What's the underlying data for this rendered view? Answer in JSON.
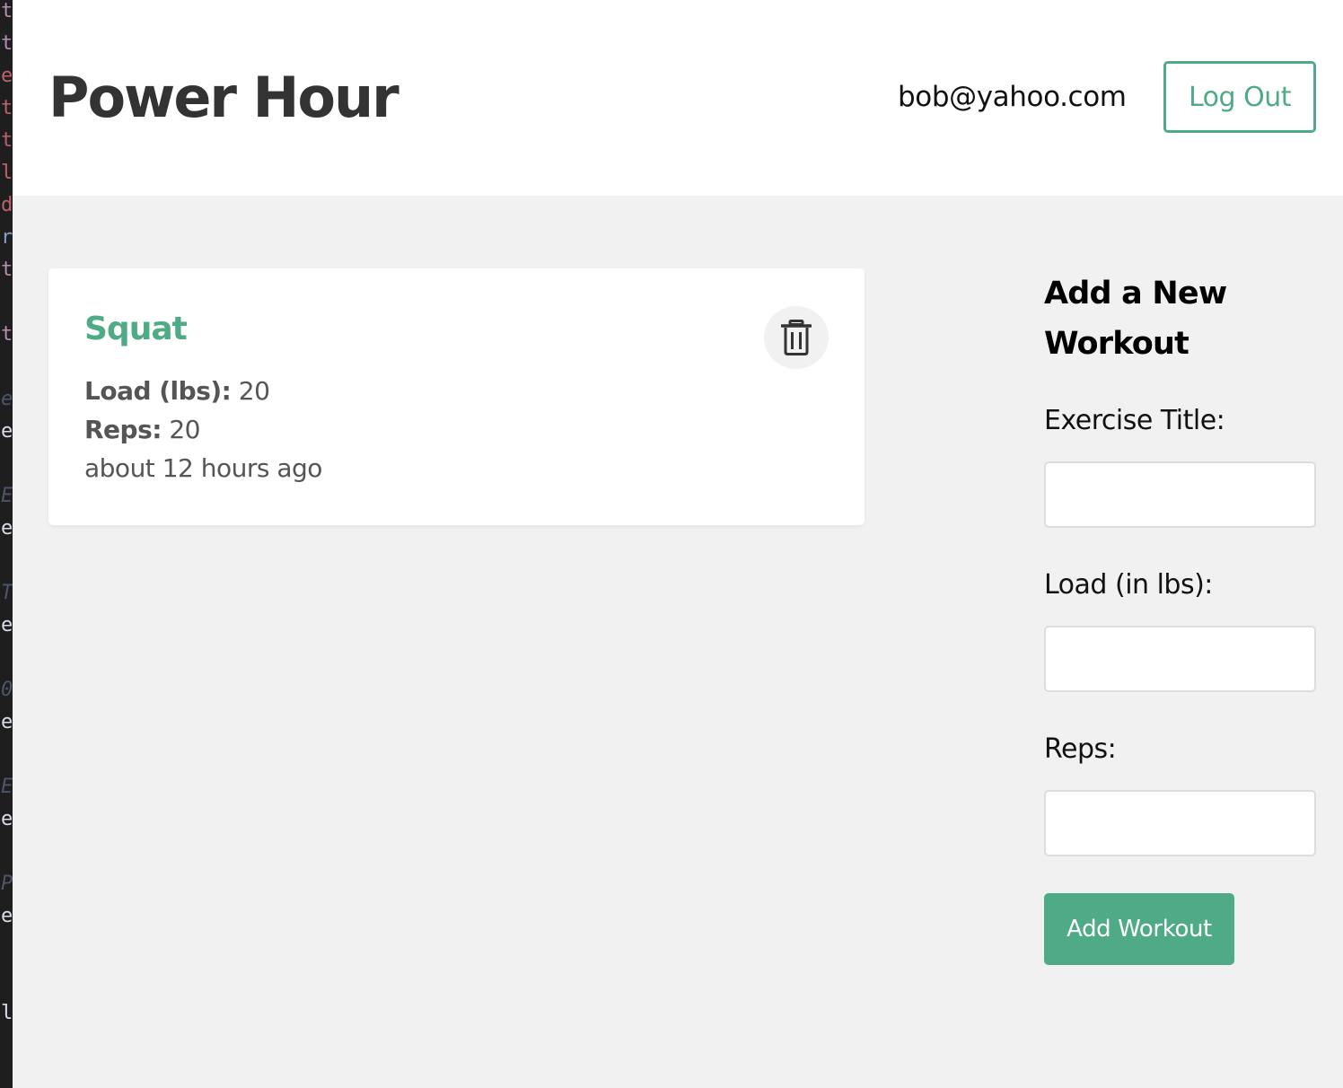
{
  "editor_strip": {
    "glyphs": [
      {
        "char": "t",
        "color": "#b48ead"
      },
      {
        "char": "t",
        "color": "#b48ead"
      },
      {
        "char": "e",
        "color": "#bf616a"
      },
      {
        "char": "t",
        "color": "#bf616a"
      },
      {
        "char": "t",
        "color": "#bf616a"
      },
      {
        "char": "l",
        "color": "#bf616a"
      },
      {
        "char": "d",
        "color": "#bf616a"
      },
      {
        "char": "r",
        "color": "#81a1c1"
      },
      {
        "char": "t",
        "color": "#b48ead"
      },
      {
        "char": "t",
        "color": "#b48ead"
      },
      {
        "char": "e",
        "color": "#4c566a"
      },
      {
        "char": "e",
        "color": "#d8dee9"
      },
      {
        "char": "E",
        "color": "#4c566a"
      },
      {
        "char": "e",
        "color": "#d8dee9"
      },
      {
        "char": "T",
        "color": "#4c566a"
      },
      {
        "char": "e",
        "color": "#d8dee9"
      },
      {
        "char": "0",
        "color": "#4c566a"
      },
      {
        "char": "e",
        "color": "#d8dee9"
      },
      {
        "char": "E",
        "color": "#4c566a"
      },
      {
        "char": "e",
        "color": "#d8dee9"
      },
      {
        "char": "P",
        "color": "#4c566a"
      },
      {
        "char": "e",
        "color": "#d8dee9"
      },
      {
        "char": "l",
        "color": "#d8dee9"
      }
    ]
  },
  "header": {
    "brand": "Power Hour",
    "user_email": "bob@yahoo.com",
    "logout_label": "Log Out"
  },
  "workouts": [
    {
      "title": "Squat",
      "load_label": "Load (lbs):",
      "load_value": " 20",
      "reps_label": "Reps:",
      "reps_value": " 20",
      "timestamp": "about 12 hours ago",
      "delete_icon": "trash-icon"
    }
  ],
  "form": {
    "heading": "Add a New Workout",
    "title_label": "Exercise Title:",
    "title_value": "",
    "load_label": "Load (in lbs):",
    "load_value": "",
    "reps_label": "Reps:",
    "reps_value": "",
    "submit_label": "Add Workout"
  },
  "colors": {
    "accent": "#4fab85",
    "page_background": "#f1f1f1",
    "card_background": "#ffffff",
    "text_dark": "#333333",
    "text_muted": "#555555"
  }
}
